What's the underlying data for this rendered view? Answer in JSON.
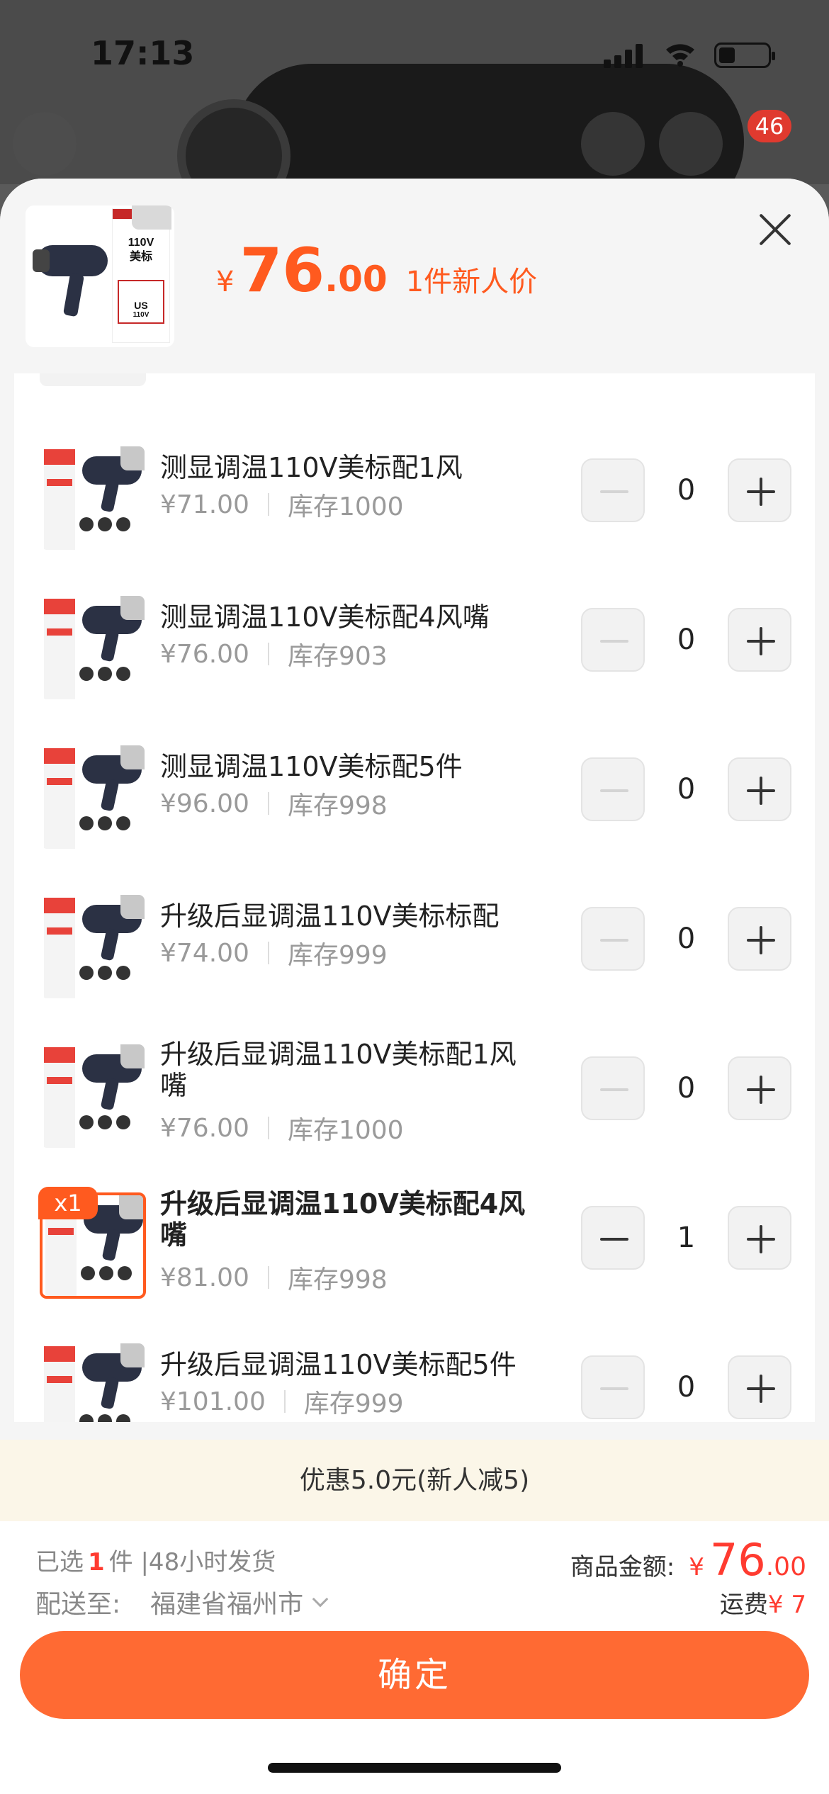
{
  "status_bar": {
    "time": "17:13"
  },
  "nav": {
    "cart_badge": "46"
  },
  "header": {
    "currency": "¥",
    "price_int": "76",
    "price_dec": ".00",
    "price_tag": "1件新人价",
    "thumb_text_1": "110V",
    "thumb_text_2": "美标",
    "thumb_box": "US",
    "thumb_box_sub": "110V"
  },
  "variants": [
    {
      "name": "测显调温110V美标配1风",
      "price": "¥71.00",
      "stock": "库存1000",
      "qty": "0",
      "selected": false
    },
    {
      "name": "测显调温110V美标配4风嘴",
      "price": "¥76.00",
      "stock": "库存903",
      "qty": "0",
      "selected": false
    },
    {
      "name": "测显调温110V美标配5件",
      "price": "¥96.00",
      "stock": "库存998",
      "qty": "0",
      "selected": false
    },
    {
      "name": "升级后显调温110V美标标配",
      "price": "¥74.00",
      "stock": "库存999",
      "qty": "0",
      "selected": false
    },
    {
      "name": "升级后显调温110V美标配1风嘴",
      "price": "¥76.00",
      "stock": "库存1000",
      "qty": "0",
      "selected": false
    },
    {
      "name": "升级后显调温110V美标配4风嘴",
      "price": "¥81.00",
      "stock": "库存998",
      "qty": "1",
      "selected": true,
      "badge": "x1"
    },
    {
      "name": "升级后显调温110V美标配5件",
      "price": "¥101.00",
      "stock": "库存999",
      "qty": "0",
      "selected": false
    }
  ],
  "promo": {
    "text": "优惠5.0元(新人减5)"
  },
  "footer": {
    "selected_prefix": "已选",
    "selected_count": "1",
    "selected_suffix": "件 |48小时发货",
    "ship_label": "配送至:",
    "ship_city": "福建省福州市",
    "total_label": "商品金额:",
    "total_currency": "¥",
    "total_int": "76",
    "total_dec": ".00",
    "freight_label": "运费",
    "freight_amount": "¥ 7",
    "confirm_label": "确定"
  },
  "colors": {
    "accent": "#ff5a1f",
    "button": "#ff6a33",
    "price_red": "#ff3b30",
    "promo_bg": "#fbf6e8"
  }
}
